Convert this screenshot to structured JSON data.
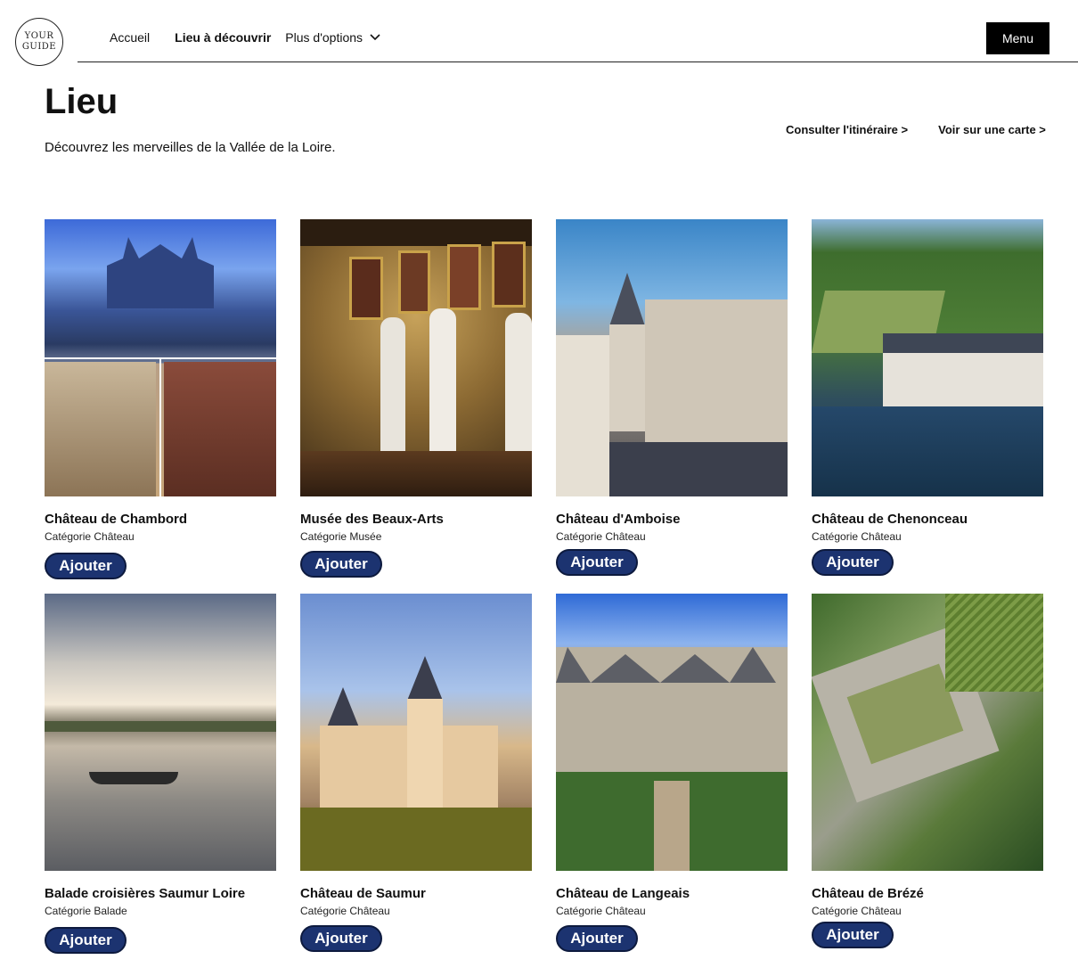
{
  "header": {
    "logo_line1": "YOUR",
    "logo_line2": "GUIDE",
    "nav": {
      "home": "Accueil",
      "discover": "Lieu à découvrir",
      "more": "Plus d'options"
    },
    "menu_label": "Menu"
  },
  "page": {
    "title": "Lieu",
    "subtitle": "Découvrez les merveilles de la Vallée de la Loire.",
    "itinerary_link": "Consulter l'itinéraire >",
    "map_link": "Voir sur une carte >"
  },
  "places": [
    {
      "name": "Château de Chambord",
      "category": "Catégorie Château",
      "button": "Ajouter"
    },
    {
      "name": "Musée des Beaux-Arts",
      "category": "Catégorie Musée",
      "button": "Ajouter"
    },
    {
      "name": "Château d'Amboise",
      "category": "Catégorie Château",
      "button": "Ajouter"
    },
    {
      "name": "Château de Chenonceau",
      "category": "Catégorie Château",
      "button": "Ajouter"
    },
    {
      "name": "Balade croisières Saumur Loire",
      "category": "Catégorie Balade",
      "button": "Ajouter"
    },
    {
      "name": "Château de Saumur",
      "category": "Catégorie Château",
      "button": "Ajouter"
    },
    {
      "name": "Château de Langeais",
      "category": "Catégorie Château",
      "button": "Ajouter"
    },
    {
      "name": "Château de Brézé",
      "category": "Catégorie Château",
      "button": "Ajouter"
    }
  ],
  "colors": {
    "button_bg": "#1c3370",
    "menu_bg": "#000000",
    "text": "#111111"
  }
}
